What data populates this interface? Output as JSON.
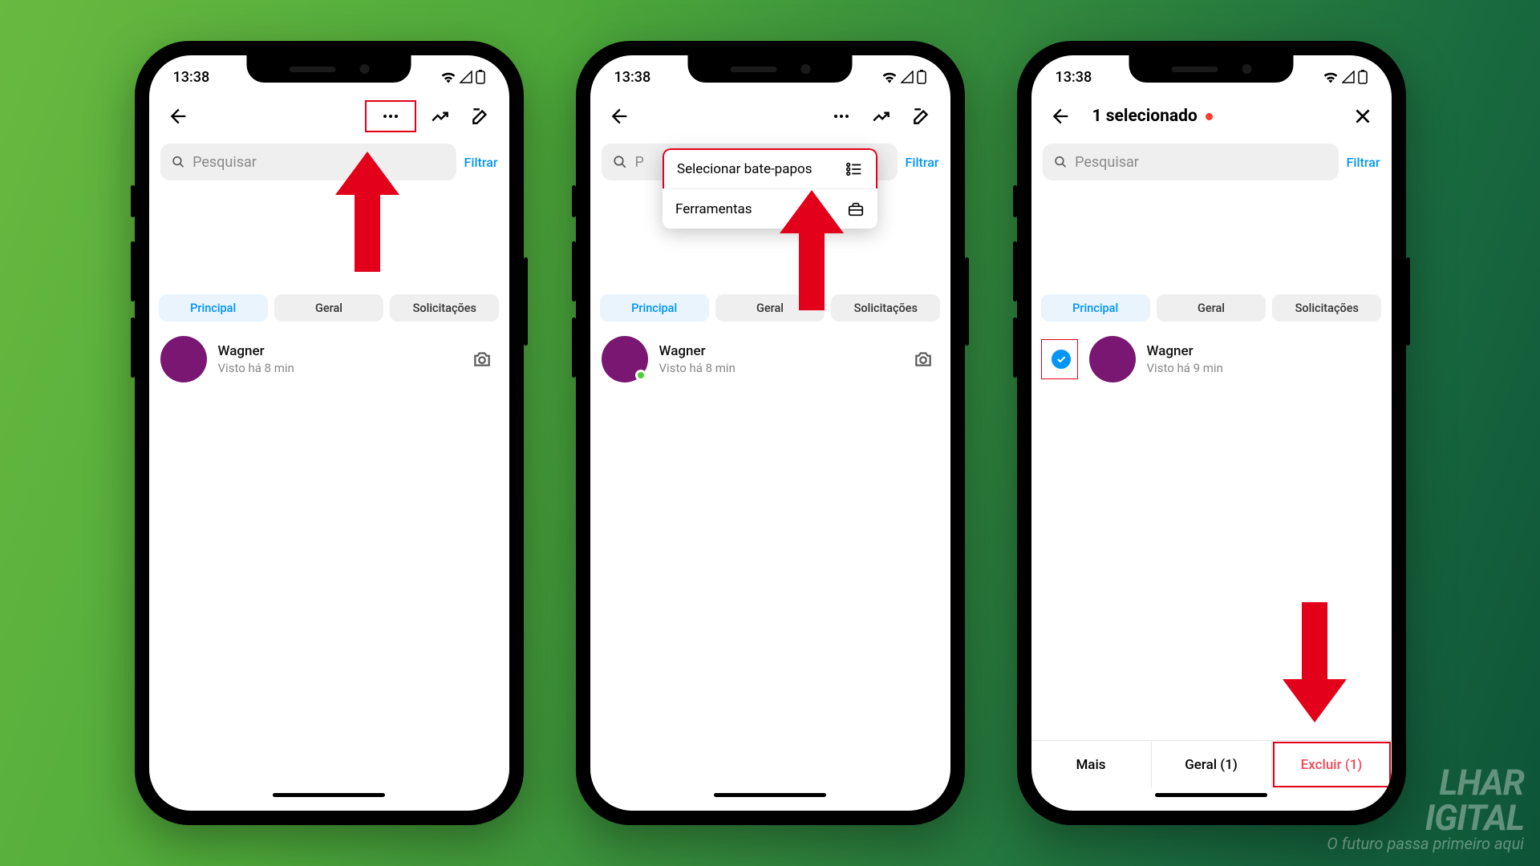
{
  "status": {
    "time": "13:38"
  },
  "search": {
    "placeholder": "Pesquisar",
    "filter": "Filtrar"
  },
  "chips": {
    "primary": "Principal",
    "general": "Geral",
    "requests": "Solicitações"
  },
  "chat": {
    "name": "Wagner",
    "sub8": "Visto há 8 min",
    "sub9": "Visto há 9 min"
  },
  "dropdown": {
    "select_chats": "Selecionar bate-papos",
    "tools": "Ferramentas"
  },
  "selection": {
    "title": "1 selecionado"
  },
  "actions": {
    "more": "Mais",
    "general_c": "Geral (1)",
    "delete_c": "Excluir (1)"
  },
  "watermark": {
    "line1": "LHAR",
    "line2": "IGITAL",
    "sub": "O futuro passa primeiro aqui"
  }
}
